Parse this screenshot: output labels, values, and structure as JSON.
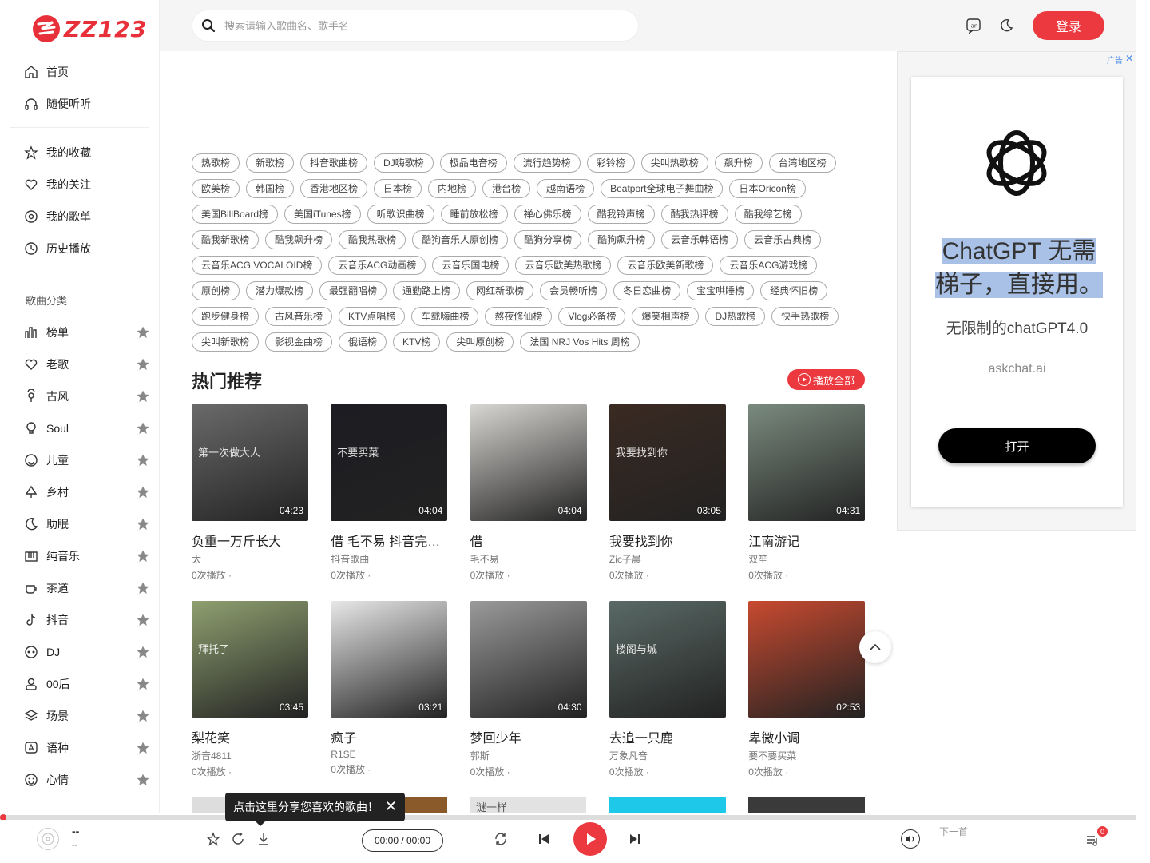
{
  "brand": {
    "name": "ZZ123",
    "accent": "#ec3940"
  },
  "header": {
    "search_placeholder": "搜索请输入歌曲名、歌手名",
    "login_label": "登录",
    "lang_icon_text": "lan"
  },
  "sidebar": {
    "top": [
      {
        "label": "首页",
        "icon": "home-icon"
      },
      {
        "label": "随便听听",
        "icon": "headphones-icon"
      }
    ],
    "mine": [
      {
        "label": "我的收藏",
        "icon": "star-icon"
      },
      {
        "label": "我的关注",
        "icon": "heart-icon"
      },
      {
        "label": "我的歌单",
        "icon": "playlist-icon"
      },
      {
        "label": "历史播放",
        "icon": "clock-icon"
      }
    ],
    "category_title": "歌曲分类",
    "categories": [
      {
        "label": "榜单",
        "icon": "chart-icon"
      },
      {
        "label": "老歌",
        "icon": "heart-outline-icon"
      },
      {
        "label": "古风",
        "icon": "flower-icon"
      },
      {
        "label": "Soul",
        "icon": "bulb-icon"
      },
      {
        "label": "儿童",
        "icon": "smile-icon"
      },
      {
        "label": "乡村",
        "icon": "tree-icon"
      },
      {
        "label": "助眠",
        "icon": "moon-icon"
      },
      {
        "label": "纯音乐",
        "icon": "piano-icon"
      },
      {
        "label": "茶道",
        "icon": "tea-icon"
      },
      {
        "label": "抖音",
        "icon": "tiktok-icon"
      },
      {
        "label": "DJ",
        "icon": "dj-icon"
      },
      {
        "label": "00后",
        "icon": "person-icon"
      },
      {
        "label": "场景",
        "icon": "layers-icon"
      },
      {
        "label": "语种",
        "icon": "language-icon"
      },
      {
        "label": "心情",
        "icon": "emoji-icon"
      }
    ]
  },
  "tags": [
    "热歌榜",
    "新歌榜",
    "抖音歌曲榜",
    "DJ嗨歌榜",
    "极品电音榜",
    "流行趋势榜",
    "彩铃榜",
    "尖叫热歌榜",
    "飙升榜",
    "台湾地区榜",
    "欧美榜",
    "韩国榜",
    "香港地区榜",
    "日本榜",
    "内地榜",
    "港台榜",
    "越南语榜",
    "Beatport全球电子舞曲榜",
    "日本Oricon榜",
    "美国BillBoard榜",
    "美国iTunes榜",
    "听歌识曲榜",
    "睡前放松榜",
    "禅心佛乐榜",
    "酷我铃声榜",
    "酷我热评榜",
    "酷我综艺榜",
    "酷我新歌榜",
    "酷我飙升榜",
    "酷我热歌榜",
    "酷狗音乐人原创榜",
    "酷狗分享榜",
    "酷狗飙升榜",
    "云音乐韩语榜",
    "云音乐古典榜",
    "云音乐ACG VOCALOID榜",
    "云音乐ACG动画榜",
    "云音乐国电榜",
    "云音乐欧美热歌榜",
    "云音乐欧美新歌榜",
    "云音乐ACG游戏榜",
    "原创榜",
    "潜力爆款榜",
    "最强翻唱榜",
    "通勤路上榜",
    "网红新歌榜",
    "会员畅听榜",
    "冬日恋曲榜",
    "宝宝哄睡榜",
    "经典怀旧榜",
    "跑步健身榜",
    "古风音乐榜",
    "KTV点唱榜",
    "车载嗨曲榜",
    "熬夜修仙榜",
    "Vlog必备榜",
    "爆笑相声榜",
    "DJ热歌榜",
    "快手热歌榜",
    "尖叫新歌榜",
    "影视金曲榜",
    "俄语榜",
    "KTV榜",
    "尖叫原创榜",
    "法国 NRJ Vos Hits 周榜"
  ],
  "section": {
    "title": "热门推荐",
    "play_all": "播放全部"
  },
  "songs": [
    {
      "title": "负重一万斤长大",
      "artist": "太一",
      "plays": "0次播放 ·",
      "duration": "04:23",
      "cover": "#6a6a6a",
      "cover_text": "第一次做大人"
    },
    {
      "title": "借 毛不易 抖音完整版",
      "artist": "抖音歌曲",
      "plays": "0次播放 ·",
      "duration": "04:04",
      "cover": "#1c1c22",
      "cover_text": "不要买菜"
    },
    {
      "title": "借",
      "artist": "毛不易",
      "plays": "0次播放 ·",
      "duration": "04:04",
      "cover": "#d8d6d2",
      "cover_text": ""
    },
    {
      "title": "我要找到你",
      "artist": "Zic子晨",
      "plays": "0次播放 ·",
      "duration": "03:05",
      "cover": "#3a2a22",
      "cover_text": "我要找到你"
    },
    {
      "title": "江南游记",
      "artist": "双笙",
      "plays": "0次播放 ·",
      "duration": "04:31",
      "cover": "#7a8a7e",
      "cover_text": ""
    },
    {
      "title": "梨花笑",
      "artist": "浙音4811",
      "plays": "0次播放 ·",
      "duration": "03:45",
      "cover": "#8fa070",
      "cover_text": "拜托了"
    },
    {
      "title": "疯子",
      "artist": "R1SE",
      "plays": "0次播放 ·",
      "duration": "03:21",
      "cover": "#e8e8e8",
      "cover_text": ""
    },
    {
      "title": "梦回少年",
      "artist": "郭斯",
      "plays": "0次播放 ·",
      "duration": "04:30",
      "cover": "#9a9a9a",
      "cover_text": ""
    },
    {
      "title": "去追一只鹿",
      "artist": "万象凡音",
      "plays": "0次播放 ·",
      "duration": "",
      "cover": "#5a6a66",
      "cover_text": "楼阁与城"
    },
    {
      "title": "卑微小调",
      "artist": "要不要买菜",
      "plays": "0次播放 ·",
      "duration": "02:53",
      "cover": "#c84a30",
      "cover_text": ""
    }
  ],
  "peek_text": "谜一样",
  "ad": {
    "tag": "广告",
    "headline_1": "ChatGPT 无需",
    "headline_2": "梯子，直接用。",
    "sub": "无限制的chatGPT4.0",
    "url": "askchat.ai",
    "button": "打开"
  },
  "toast": "点击这里分享您喜欢的歌曲！",
  "player": {
    "song": "--",
    "artist": "--",
    "time": "00:00 / 00:00",
    "next_label": "下一首",
    "queue_count": "0",
    "progress": 0
  }
}
